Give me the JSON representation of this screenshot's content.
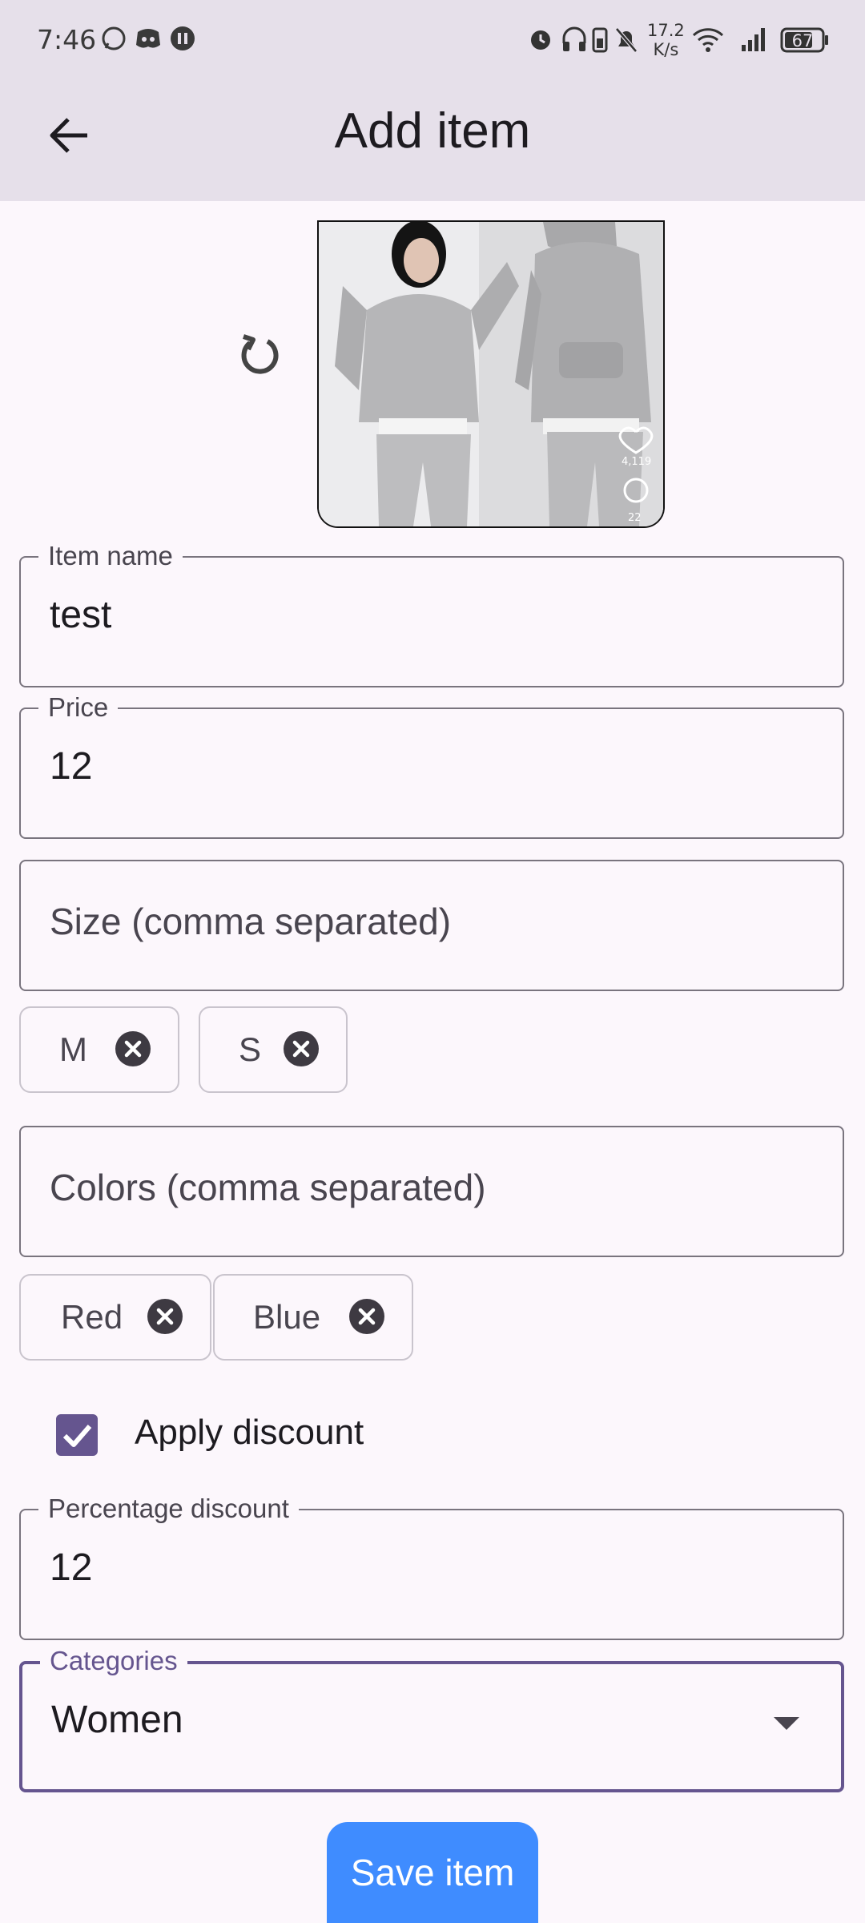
{
  "status_bar": {
    "time": "7:46",
    "speed_value": "17.2",
    "speed_unit": "K/s",
    "battery": "67",
    "left_icons": [
      "whatsapp-icon",
      "discord-icon",
      "pause-icon"
    ],
    "right_icons": [
      "alarm-icon",
      "headphones-icon",
      "battery-saver-icon",
      "bell-off-icon",
      "wifi-icon",
      "signal-icon",
      "battery-icon"
    ]
  },
  "app_bar": {
    "title": "Add item",
    "back_icon": "arrow-back-icon"
  },
  "image_preview": {
    "likes": "4,119",
    "comments": "22",
    "rotate_icon": "rotate-icon"
  },
  "form": {
    "item_name": {
      "label": "Item name",
      "value": "test"
    },
    "price": {
      "label": "Price",
      "value": "12"
    },
    "size": {
      "placeholder": "Size (comma separated)",
      "chips": [
        "M",
        "S"
      ]
    },
    "colors": {
      "placeholder": "Colors (comma separated)",
      "chips": [
        "Red",
        "Blue"
      ]
    },
    "apply_discount": {
      "label": "Apply discount",
      "checked": true
    },
    "percentage_discount": {
      "label": "Percentage discount",
      "value": "12"
    },
    "categories": {
      "label": "Categories",
      "value": "Women"
    }
  },
  "save_button": {
    "label": "Save item"
  },
  "colors": {
    "accent": "#65558f",
    "button": "#3f8cff",
    "surface": "#fcf7fc",
    "app_bar": "#e6e0ea"
  }
}
